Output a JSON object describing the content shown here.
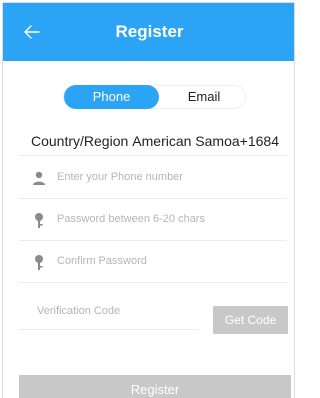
{
  "header": {
    "title": "Register",
    "back_icon": "arrow-left-icon",
    "background": "#2ba4f5"
  },
  "tabs": {
    "phone": "Phone",
    "email": "Email",
    "active": "Phone"
  },
  "country": {
    "label": "Country/Region",
    "value": "American Samoa+1684"
  },
  "fields": {
    "phone_placeholder": "Enter your Phone number",
    "password_placeholder": "Password between 6-20 chars",
    "confirm_placeholder": "Confirm Password",
    "code_placeholder": "Verification Code"
  },
  "buttons": {
    "get_code": "Get Code",
    "register": "Register"
  },
  "icons": {
    "phone_field": "user-icon",
    "password_field": "key-icon",
    "confirm_field": "key-icon"
  }
}
